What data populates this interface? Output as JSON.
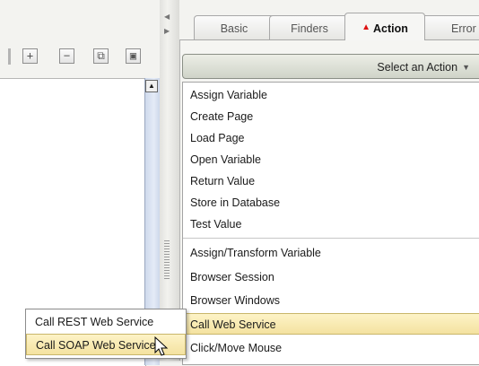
{
  "tabs": [
    {
      "label": "Basic",
      "active": false
    },
    {
      "label": "Finders",
      "active": false
    },
    {
      "label": "Action",
      "active": true,
      "icon": "warning-icon"
    },
    {
      "label": "Error",
      "active": false
    }
  ],
  "toolbar": {
    "buttons": [
      {
        "name": "add-icon",
        "glyph": "+"
      },
      {
        "name": "remove-icon",
        "glyph": "−"
      },
      {
        "name": "copy-icon",
        "glyph": "⧉"
      },
      {
        "name": "zoom-icon",
        "glyph": "▣"
      }
    ]
  },
  "action_selector": {
    "label": "Select an Action",
    "arrow": "▼"
  },
  "action_menu": {
    "group1": [
      "Assign Variable",
      "Create Page",
      "Load Page",
      "Open Variable",
      "Return Value",
      "Store in Database",
      "Test Value"
    ],
    "group2": [
      "Assign/Transform Variable",
      "Browser Session",
      "Browser Windows",
      "Call Web Service",
      "Click/Move Mouse"
    ],
    "selected": "Call Web Service"
  },
  "submenu": {
    "items": [
      "Call REST Web Service",
      "Call SOAP Web Service"
    ],
    "selected": "Call SOAP Web Service"
  },
  "colors": {
    "highlight": "#f8e8ae",
    "warning": "#dd1111",
    "scrollbar": "#dbe3f2"
  }
}
